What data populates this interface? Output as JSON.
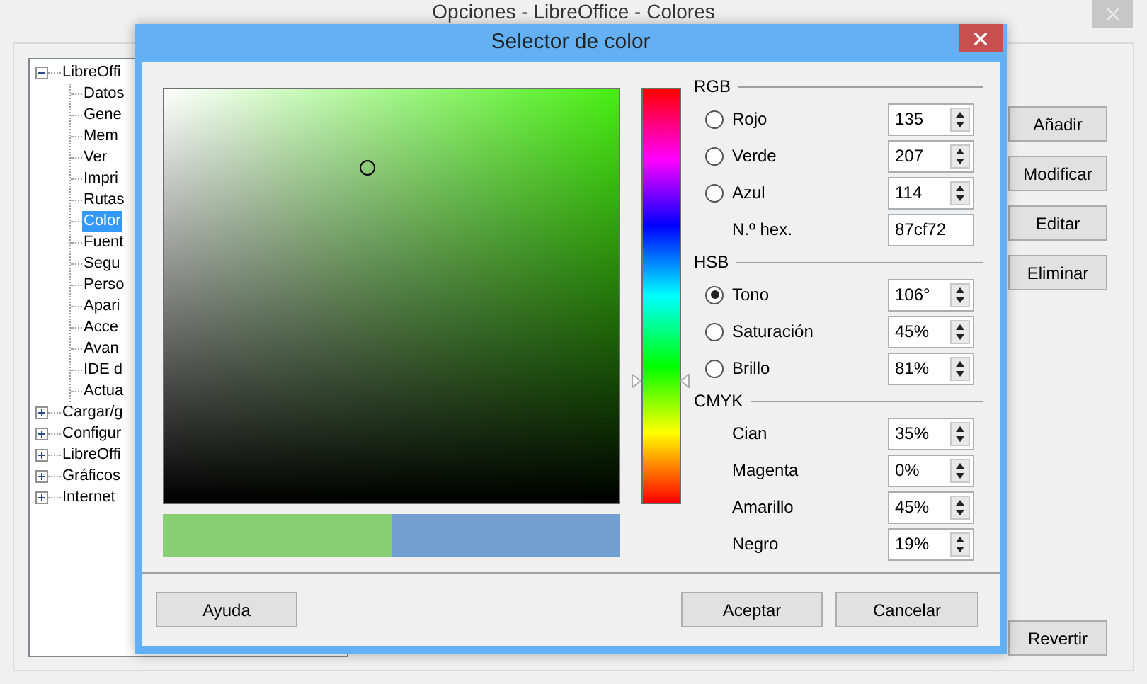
{
  "main_window": {
    "title": "Opciones - LibreOffice - Colores",
    "tree": [
      {
        "label": "LibreOffi",
        "expanded": true,
        "selected": false,
        "children": [
          {
            "label": "Datos",
            "selected": false
          },
          {
            "label": "Gene",
            "selected": false
          },
          {
            "label": "Mem",
            "selected": false
          },
          {
            "label": "Ver",
            "selected": false
          },
          {
            "label": "Impri",
            "selected": false
          },
          {
            "label": "Rutas",
            "selected": false
          },
          {
            "label": "Color",
            "selected": true
          },
          {
            "label": "Fuent",
            "selected": false
          },
          {
            "label": "Segu",
            "selected": false
          },
          {
            "label": "Perso",
            "selected": false
          },
          {
            "label": "Apari",
            "selected": false
          },
          {
            "label": "Acce",
            "selected": false
          },
          {
            "label": "Avan",
            "selected": false
          },
          {
            "label": "IDE d",
            "selected": false
          },
          {
            "label": "Actua",
            "selected": false
          }
        ]
      },
      {
        "label": "Cargar/g",
        "expanded": false,
        "selected": false
      },
      {
        "label": "Configur",
        "expanded": false,
        "selected": false
      },
      {
        "label": "LibreOffi",
        "expanded": false,
        "selected": false
      },
      {
        "label": "Gráficos",
        "expanded": false,
        "selected": false
      },
      {
        "label": "Internet",
        "expanded": false,
        "selected": false
      }
    ],
    "buttons": [
      "Añadir",
      "Modificar",
      "Editar",
      "Eliminar"
    ],
    "revert_button": "Revertir"
  },
  "dialog": {
    "title": "Selector de color",
    "swatches": [
      {
        "color": "#87cf72"
      },
      {
        "color": "#729fcf"
      }
    ],
    "sections": [
      {
        "title": "RGB",
        "rows": [
          {
            "kind": "radio",
            "label": "Rojo",
            "selected": false,
            "value": "135"
          },
          {
            "kind": "radio",
            "label": "Verde",
            "selected": false,
            "value": "207"
          },
          {
            "kind": "radio",
            "label": "Azul",
            "selected": false,
            "value": "114"
          },
          {
            "kind": "text",
            "label": "N.º hex.",
            "value": "87cf72"
          }
        ]
      },
      {
        "title": "HSB",
        "rows": [
          {
            "kind": "radio",
            "label": "Tono",
            "selected": true,
            "value": "106°"
          },
          {
            "kind": "radio",
            "label": "Saturación",
            "selected": false,
            "value": "45%"
          },
          {
            "kind": "radio",
            "label": "Brillo",
            "selected": false,
            "value": "81%"
          }
        ]
      },
      {
        "title": "CMYK",
        "rows": [
          {
            "kind": "spin",
            "label": "Cian",
            "value": "35%"
          },
          {
            "kind": "spin",
            "label": "Magenta",
            "value": "0%"
          },
          {
            "kind": "spin",
            "label": "Amarillo",
            "value": "45%"
          },
          {
            "kind": "spin",
            "label": "Negro",
            "value": "19%"
          }
        ]
      }
    ],
    "buttons": {
      "help": "Ayuda",
      "ok": "Aceptar",
      "cancel": "Cancelar"
    }
  }
}
